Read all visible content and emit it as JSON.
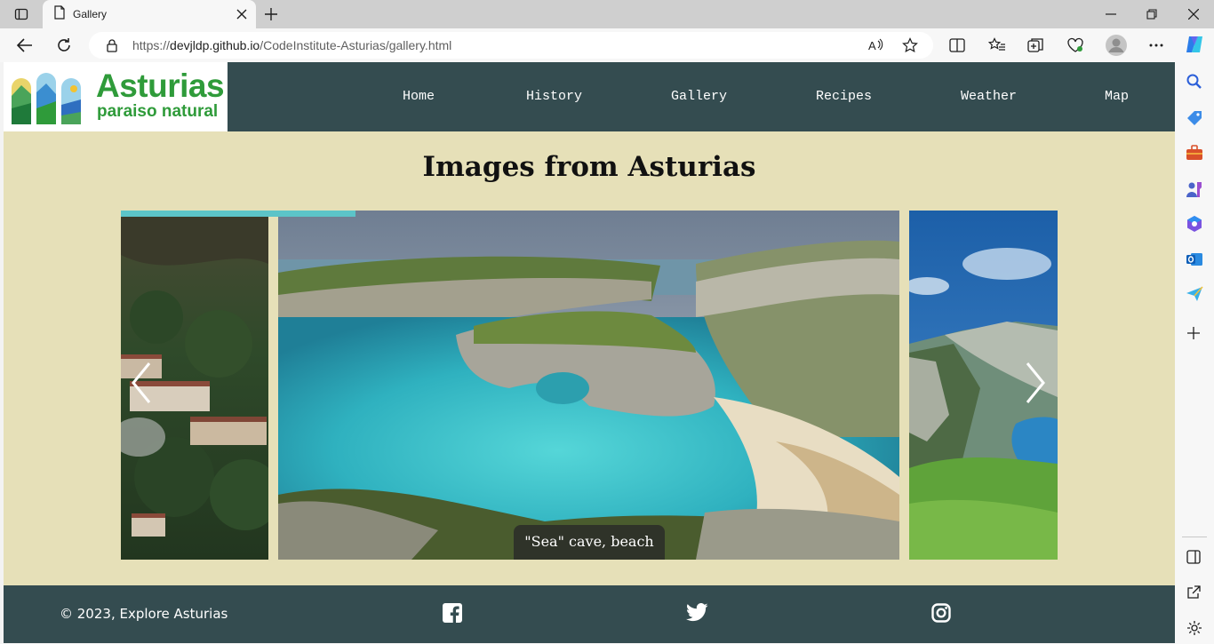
{
  "browser": {
    "tab_title": "Gallery",
    "url_scheme": "https://",
    "url_host": "devjldp.github.io",
    "url_path": "/CodeInstitute-Asturias/gallery.html"
  },
  "site": {
    "logo_title": "Asturias",
    "logo_subtitle": "paraiso natural",
    "nav": [
      "Home",
      "History",
      "Gallery",
      "Recipes",
      "Weather",
      "Map"
    ]
  },
  "gallery": {
    "title": "Images from Asturias",
    "caption": "\"Sea\" cave, beach",
    "progress": 0.25
  },
  "footer": {
    "copyright": "© 2023, Explore Asturias",
    "social": [
      "facebook-icon",
      "twitter-icon",
      "instagram-icon"
    ]
  },
  "colors": {
    "header": "#344c50",
    "page_bg": "#e6e0b8",
    "accent": "#5cc4c8",
    "logo_green": "#2f9b3a"
  }
}
